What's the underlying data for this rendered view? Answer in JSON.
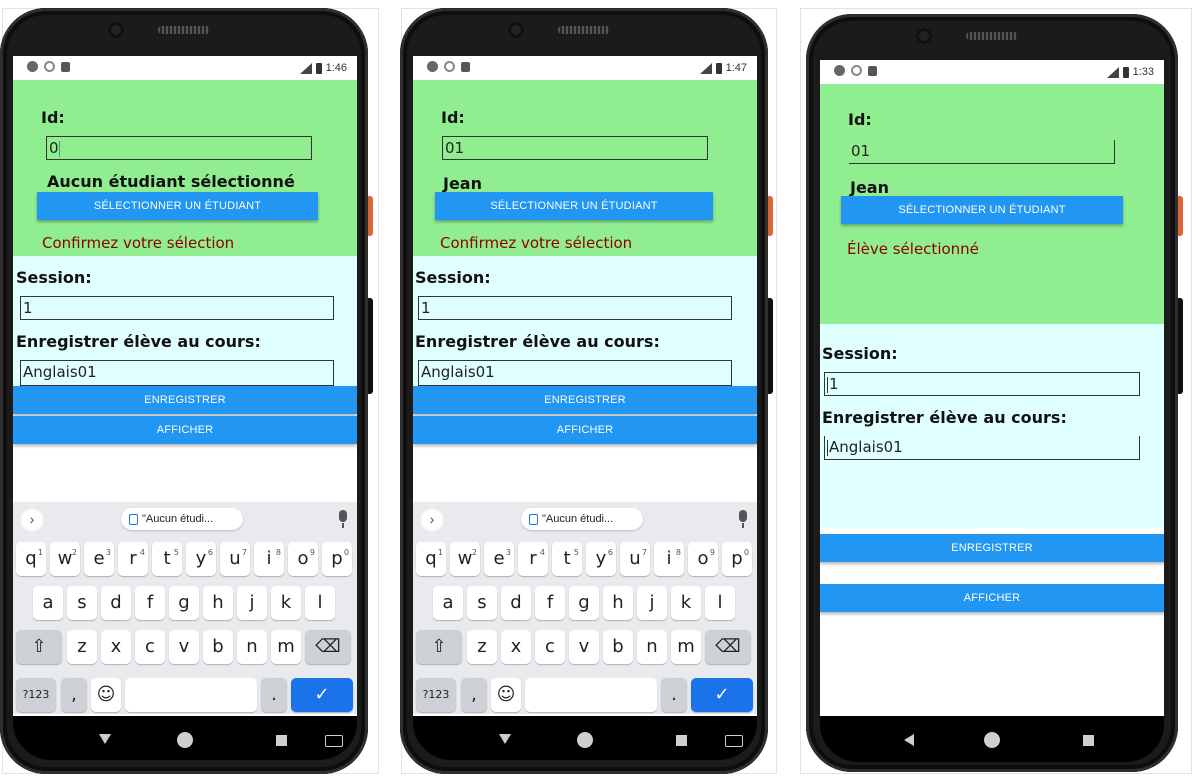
{
  "phones": [
    {
      "time": "1:46",
      "id_label": "Id:",
      "id_value": "0",
      "student_name": "Aucun étudiant sélectionné",
      "select_button": "SÉLECTIONNER UN ÉTUDIANT",
      "confirm_text": "Confirmez votre sélection",
      "session_label": "Session:",
      "session_value": "1",
      "course_label": "Enregistrer élève au cours:",
      "course_value": "Anglais01",
      "save_button": "ENREGISTRER",
      "show_button": "AFFICHER",
      "clipboard_text": "\"Aucun étudi...",
      "keyboard_visible": true
    },
    {
      "time": "1:47",
      "id_label": "Id:",
      "id_value": "01",
      "student_name": "Jean",
      "select_button": "SÉLECTIONNER UN ÉTUDIANT",
      "confirm_text": "Confirmez votre sélection",
      "session_label": "Session:",
      "session_value": "1",
      "course_label": "Enregistrer élève au cours:",
      "course_value": "Anglais01",
      "save_button": "ENREGISTRER",
      "show_button": "AFFICHER",
      "clipboard_text": "\"Aucun étudi...",
      "keyboard_visible": true
    },
    {
      "time": "1:33",
      "id_label": "Id:",
      "id_value": "01",
      "student_name": "Jean",
      "select_button": "SÉLECTIONNER UN ÉTUDIANT",
      "confirm_text": "Élève sélectionné",
      "session_label": "Session:",
      "session_value": "1",
      "course_label": "Enregistrer élève au cours:",
      "course_value": "Anglais01",
      "save_button": "ENREGISTRER",
      "show_button": "AFFICHER",
      "keyboard_visible": false
    }
  ],
  "keyboard": {
    "row1": [
      [
        "q",
        "1"
      ],
      [
        "w",
        "2"
      ],
      [
        "e",
        "3"
      ],
      [
        "r",
        "4"
      ],
      [
        "t",
        "5"
      ],
      [
        "y",
        "6"
      ],
      [
        "u",
        "7"
      ],
      [
        "i",
        "8"
      ],
      [
        "o",
        "9"
      ],
      [
        "p",
        "0"
      ]
    ],
    "row2": [
      "a",
      "s",
      "d",
      "f",
      "g",
      "h",
      "j",
      "k",
      "l"
    ],
    "row3": [
      "z",
      "x",
      "c",
      "v",
      "b",
      "n",
      "m"
    ],
    "symbols_key": "?123",
    "comma_key": ",",
    "period_key": "."
  },
  "colors": {
    "top_panel": "#90ee90",
    "bottom_panel": "#e0ffff",
    "button": "#2196f3",
    "confirm_text": "#8b0000"
  }
}
